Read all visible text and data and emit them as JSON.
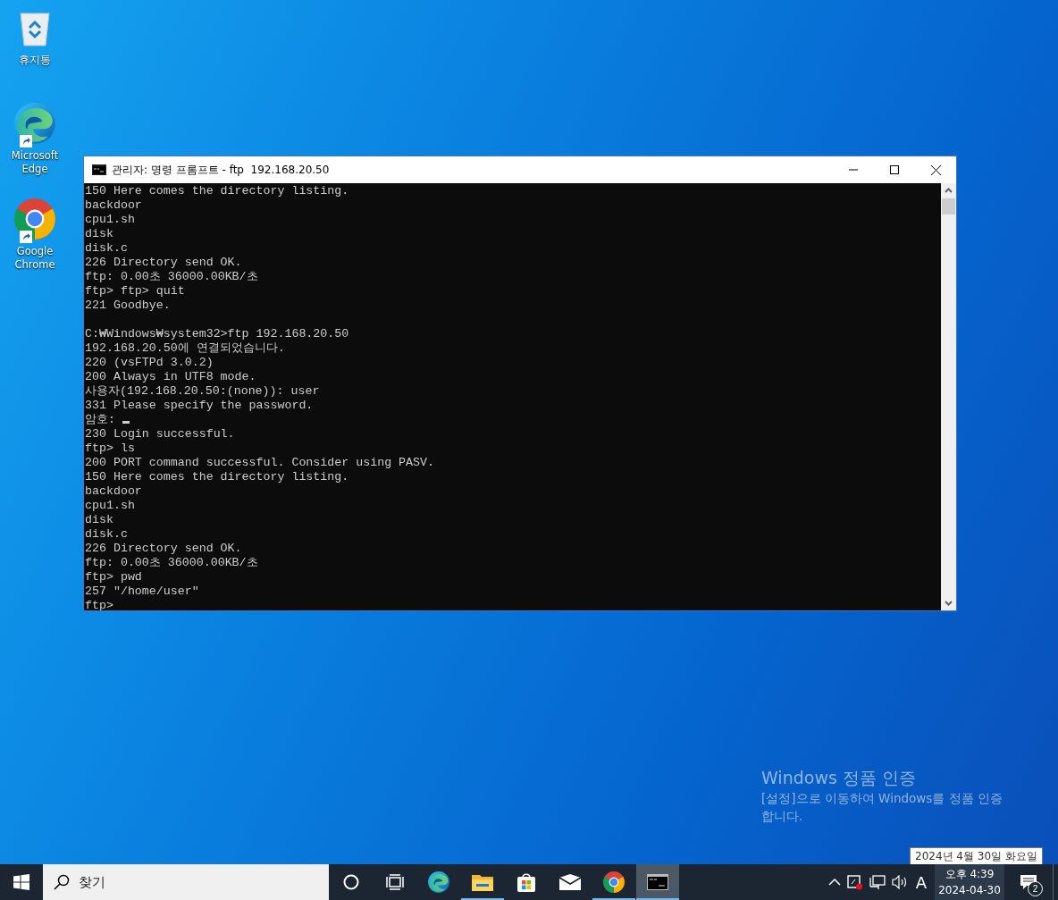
{
  "desktop_icons": [
    {
      "kind": "recycle",
      "label": "휴지통",
      "shortcut": false
    },
    {
      "kind": "edge",
      "label": "Microsoft Edge",
      "shortcut": true
    },
    {
      "kind": "chrome",
      "label": "Google Chrome",
      "shortcut": true
    }
  ],
  "console_window": {
    "title": "관리자: 명령 프롬프트 - ftp  192.168.20.50",
    "lines": [
      "150 Here comes the directory listing.",
      "backdoor",
      "cpu1.sh",
      "disk",
      "disk.c",
      "226 Directory send OK.",
      "ftp: 0.00초 36000.00KB/초",
      "ftp> ftp> quit",
      "221 Goodbye.",
      {
        "kind": "blank"
      },
      "C:₩Windows₩system32>ftp 192.168.20.50",
      "192.168.20.50에 연결되었습니다.",
      "220 (vsFTPd 3.0.2)",
      "200 Always in UTF8 mode.",
      "사용자(192.168.20.50:(none)): user",
      "331 Please specify the password.",
      {
        "kind": "cursor",
        "text": "암호:"
      },
      "230 Login successful.",
      "ftp> ls",
      "200 PORT command successful. Consider using PASV.",
      "150 Here comes the directory listing.",
      "backdoor",
      "cpu1.sh",
      "disk",
      "disk.c",
      "226 Directory send OK.",
      "ftp: 0.00초 36000.00KB/초",
      "ftp> pwd",
      "257 \"/home/user\"",
      "ftp>"
    ]
  },
  "activation": {
    "title": "Windows 정품 인증",
    "message_lines": [
      "[설정]으로 이동하여 Windows를 정품 인증",
      "합니다."
    ]
  },
  "date_tooltip": "2024년 4월 30일 화요일",
  "taskbar": {
    "search": {
      "placeholder": "찾기"
    },
    "apps": [
      {
        "kind": "cortana",
        "running": false,
        "selected": false
      },
      {
        "kind": "taskview",
        "running": false,
        "selected": false
      },
      {
        "kind": "edge",
        "running": false,
        "selected": false
      },
      {
        "kind": "explorer",
        "running": true,
        "selected": false
      },
      {
        "kind": "store",
        "running": false,
        "selected": false
      },
      {
        "kind": "mail",
        "running": false,
        "selected": false
      },
      {
        "kind": "chrome",
        "running": true,
        "selected": false
      },
      {
        "kind": "console",
        "running": true,
        "selected": true
      }
    ],
    "input_indicator": "A",
    "time": "오후 4:39",
    "date": "2024-04-30",
    "notification_count": "2"
  }
}
